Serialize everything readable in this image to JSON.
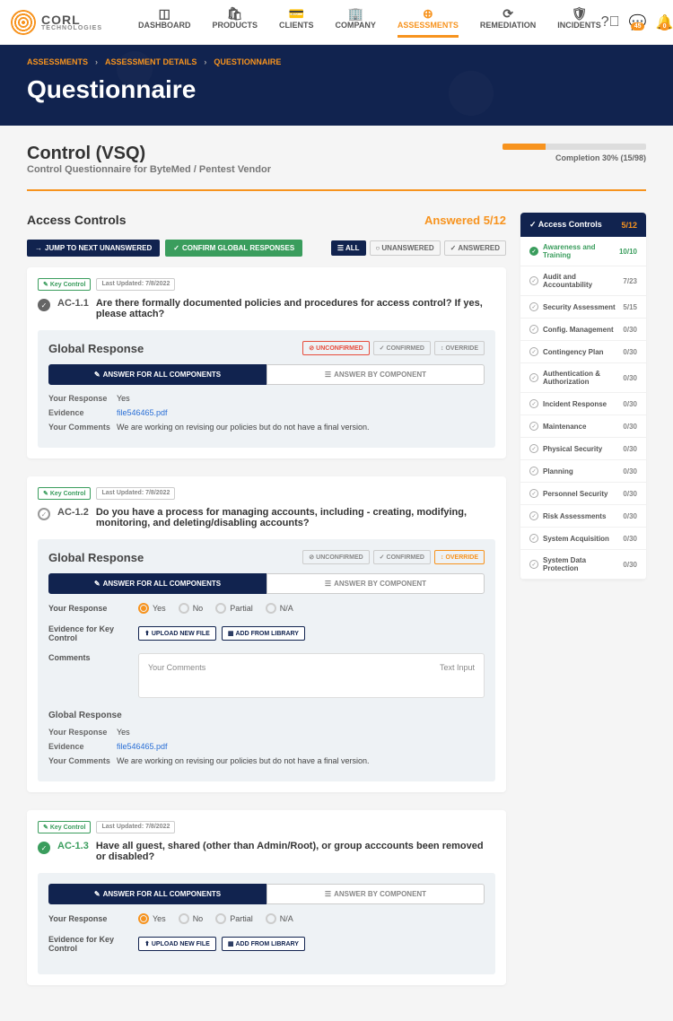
{
  "logo": {
    "name": "CORL",
    "sub": "TECHNOLOGIES"
  },
  "nav": [
    {
      "label": "DASHBOARD"
    },
    {
      "label": "PRODUCTS"
    },
    {
      "label": "CLIENTS"
    },
    {
      "label": "COMPANY"
    },
    {
      "label": "ASSESSMENTS"
    },
    {
      "label": "REMEDIATION"
    },
    {
      "label": "INCIDENTS"
    }
  ],
  "badges": {
    "messages": "45",
    "notifications": "0"
  },
  "breadcrumb": [
    "ASSESSMENTS",
    "ASSESSMENT DETAILS",
    "QUESTIONNAIRE"
  ],
  "hero_title": "Questionnaire",
  "control": {
    "title": "Control (VSQ)",
    "subtitle": "Control Questionnaire for ByteMed / Pentest Vendor"
  },
  "progress": {
    "text": "Completion 30% (15/98)"
  },
  "section": {
    "title": "Access Controls",
    "answered": "Answered 5/12"
  },
  "toolbar": {
    "jump": "JUMP TO NEXT UNANSWERED",
    "confirm": "CONFIRM GLOBAL RESPONSES"
  },
  "filters": {
    "all": "ALL",
    "unanswered": "UNANSWERED",
    "answered": "ANSWERED"
  },
  "tags": {
    "key": "Key Control",
    "updated": "Last Updated: 7/8/2022"
  },
  "chips": {
    "unconfirmed": "UNCONFIRMED",
    "confirmed": "CONFIRMED",
    "override": "OVERRIDE"
  },
  "tabs": {
    "all": "ANSWER FOR ALL COMPONENTS",
    "by": "ANSWER BY COMPONENT"
  },
  "labels": {
    "global_response": "Global Response",
    "your_response": "Your Response",
    "evidence": "Evidence",
    "your_comments": "Your Comments",
    "comments": "Comments",
    "evidence_key": "Evidence for Key Control",
    "upload": "UPLOAD NEW FILE",
    "library": "ADD FROM LIBRARY",
    "placeholder": "Your Comments",
    "hint": "Text Input"
  },
  "radio": {
    "yes": "Yes",
    "no": "No",
    "partial": "Partial",
    "na": "N/A"
  },
  "q1": {
    "id": "AC-1.1",
    "text": "Are there formally documented policies and procedures for access control? If yes, please attach?",
    "response": "Yes",
    "evidence": "file546465.pdf",
    "comments": "We are working on revising our policies but do not have a final version."
  },
  "q2": {
    "id": "AC-1.2",
    "text": "Do you have a process for managing accounts, including - creating, modifying, monitoring, and deleting/disabling accounts?",
    "gr_response": "Yes",
    "gr_evidence": "file546465.pdf",
    "gr_comments": "We are working on revising our policies but do not have a final version."
  },
  "q3": {
    "id": "AC-1.3",
    "text": "Have all guest, shared (other than Admin/Root), or group acccounts been removed or disabled?"
  },
  "sidebar": {
    "header": {
      "label": "Access Controls",
      "count": "5/12"
    },
    "items": [
      {
        "label": "Awareness and Training",
        "count": "10/10"
      },
      {
        "label": "Audit and Accountability",
        "count": "7/23"
      },
      {
        "label": "Security Assessment",
        "count": "5/15"
      },
      {
        "label": "Config. Management",
        "count": "0/30"
      },
      {
        "label": "Contingency Plan",
        "count": "0/30"
      },
      {
        "label": "Authentication & Authorization",
        "count": "0/30"
      },
      {
        "label": "Incident Response",
        "count": "0/30"
      },
      {
        "label": "Maintenance",
        "count": "0/30"
      },
      {
        "label": "Physical Security",
        "count": "0/30"
      },
      {
        "label": "Planning",
        "count": "0/30"
      },
      {
        "label": "Personnel Security",
        "count": "0/30"
      },
      {
        "label": "Risk Assessments",
        "count": "0/30"
      },
      {
        "label": "System Acquisition",
        "count": "0/30"
      },
      {
        "label": "System Data Protection",
        "count": "0/30"
      }
    ]
  }
}
